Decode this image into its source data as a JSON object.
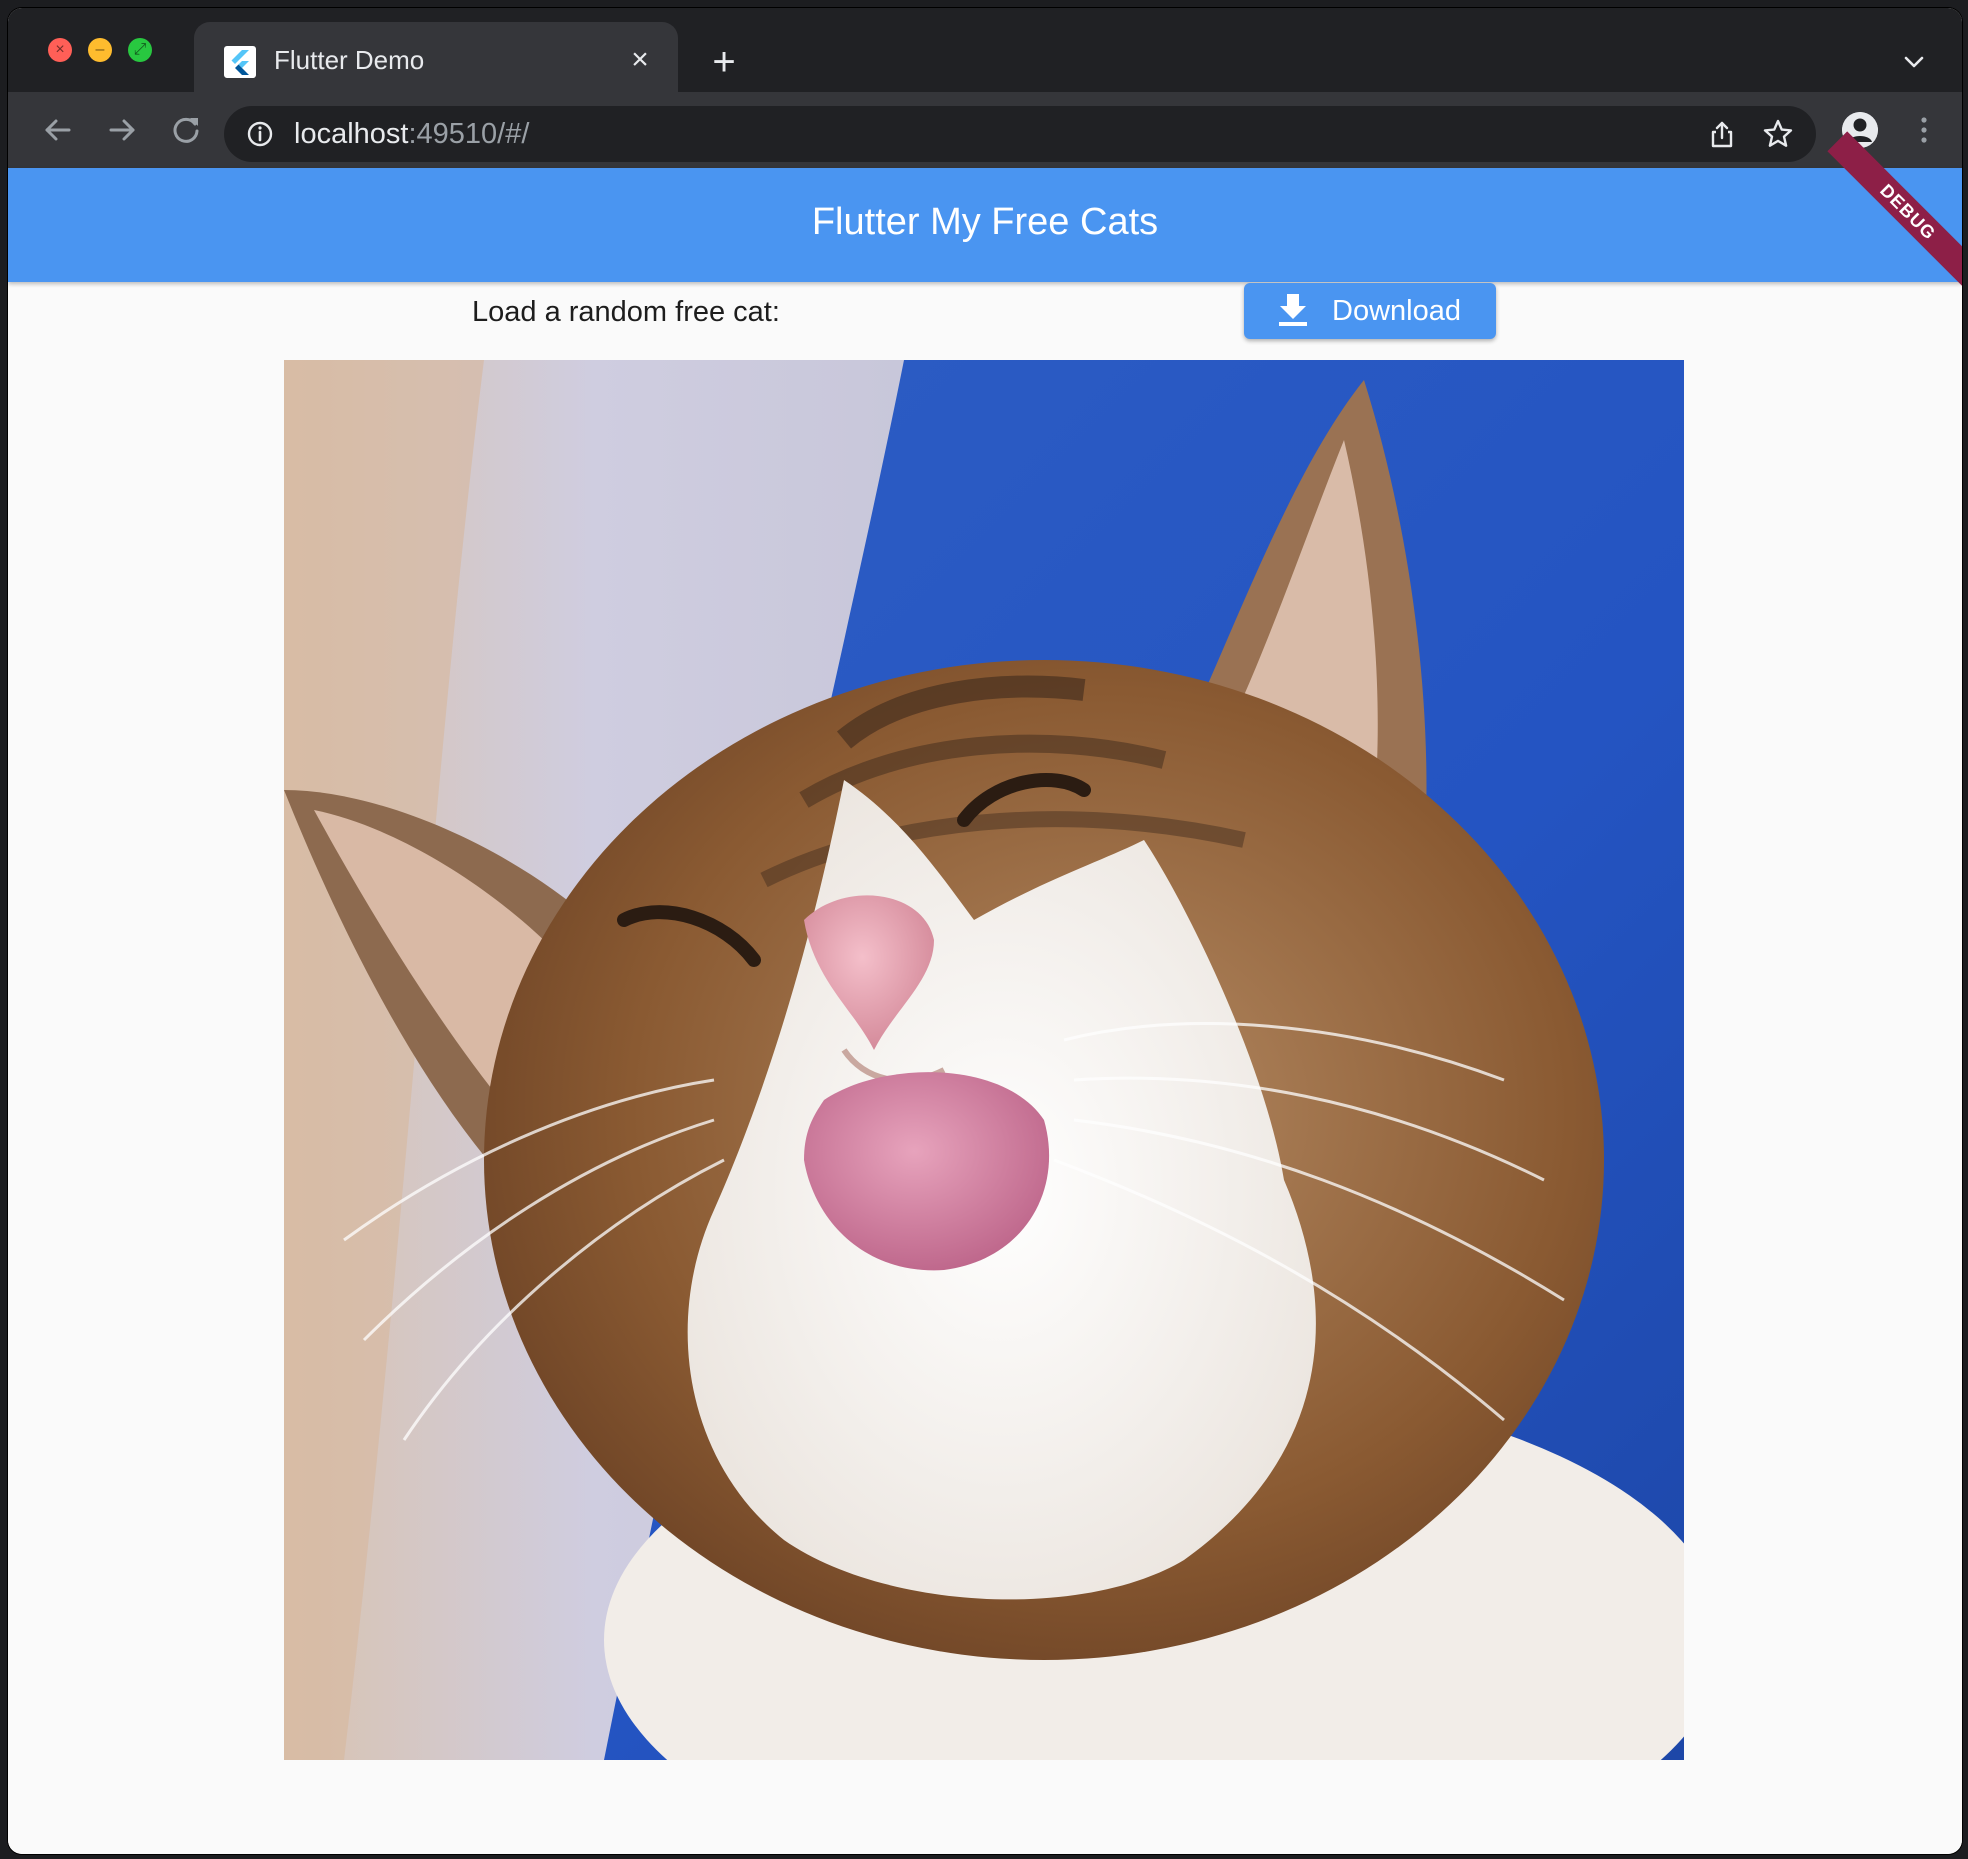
{
  "browser": {
    "tab": {
      "title": "Flutter Demo"
    },
    "omnibox": {
      "host": "localhost",
      "rest": ":49510/#/"
    }
  },
  "app": {
    "title": "Flutter My Free Cats",
    "debug_banner": "DEBUG",
    "prompt_label": "Load a random free cat:",
    "download_label": "Download",
    "accent_color": "#4a95f1"
  },
  "icons": {
    "window_controls": [
      "close-icon",
      "minimize-icon",
      "maximize-icon"
    ],
    "navigation": [
      "back-arrow-icon",
      "forward-arrow-icon",
      "reload-icon"
    ],
    "omnibox": [
      "info-icon",
      "share-icon",
      "star-icon"
    ],
    "toolbar_right": [
      "profile-icon",
      "kebab-menu-icon"
    ],
    "button": "download-icon"
  }
}
